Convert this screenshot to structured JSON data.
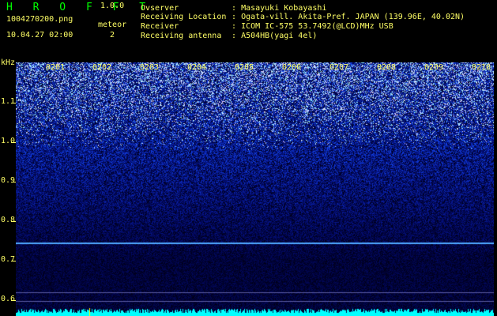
{
  "header": {
    "app_title": "H R O F F T",
    "version": "1.0.0",
    "file_name": "1004270200.png",
    "date_time": "10.04.27 02:00",
    "meteor_label": "meteor",
    "meteor_count": "2"
  },
  "info": [
    {
      "key": "Ovserver",
      "sep": ":",
      "value": "Masayuki Kobayashi"
    },
    {
      "key": "Receiving Location",
      "sep": ":",
      "value": "Ogata-vill. Akita-Pref. JAPAN (139.96E, 40.02N)"
    },
    {
      "key": "Receiver",
      "sep": ":",
      "value": "ICOM IC-575 53.7492(@LCD)MHz USB"
    },
    {
      "key": "Receiving antenna",
      "sep": ":",
      "value": "A504HB(yagi 4el)"
    }
  ],
  "axis": {
    "unit": "kHz",
    "y_ticks": [
      "1.1",
      "1.0",
      "0.9",
      "0.8",
      "0.7",
      "0.6"
    ],
    "x_ticks": [
      "0201",
      "0202",
      "0203",
      "0204",
      "0205",
      "0206",
      "0207",
      "0208",
      "0209",
      "0210"
    ]
  },
  "colors": {
    "background": "#000000",
    "text": "#ffff66",
    "title": "#00ff00",
    "signal_line": "#4fa8ff",
    "noise_strip": "#00ffff"
  }
}
